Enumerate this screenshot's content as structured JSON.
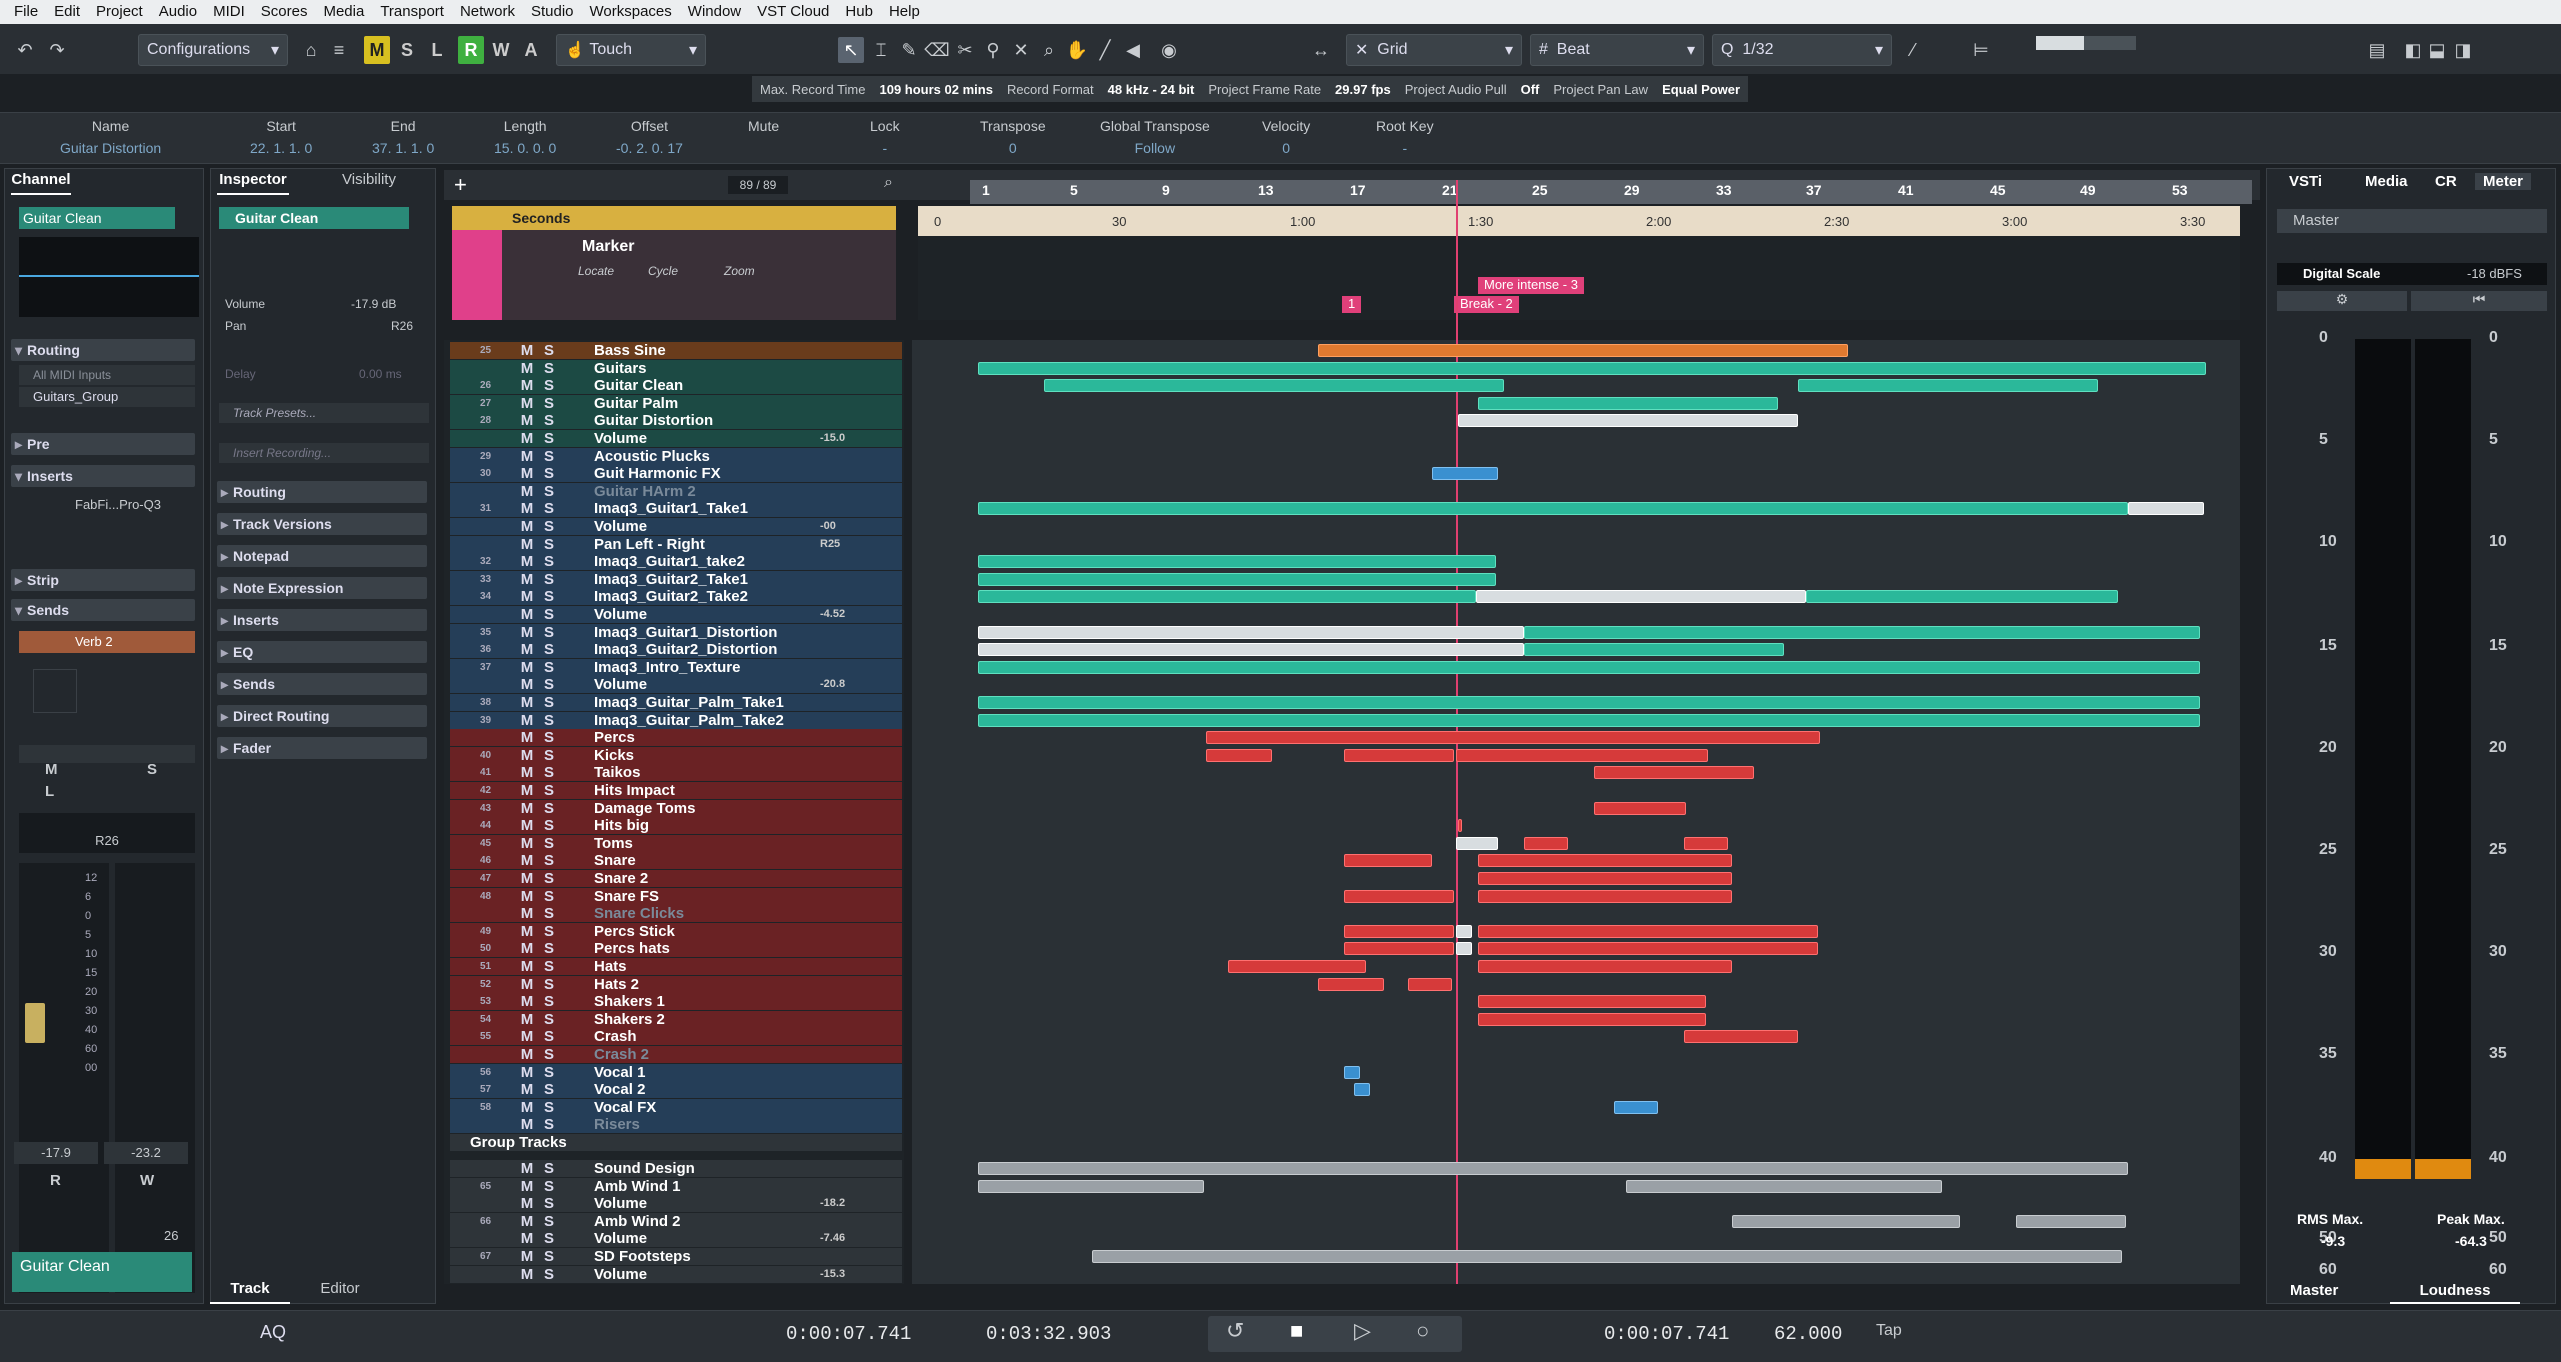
{
  "menu": [
    "File",
    "Edit",
    "Project",
    "Audio",
    "MIDI",
    "Scores",
    "Media",
    "Transport",
    "Network",
    "Studio",
    "Workspaces",
    "Window",
    "VST Cloud",
    "Hub",
    "Help"
  ],
  "toolbar": {
    "configurations": "Configurations",
    "automation_mode": "Touch",
    "snap_type": "Grid",
    "grid_type": "Beat",
    "quantize": "1/32",
    "ms_buttons": [
      "M",
      "S",
      "L",
      "R",
      "W",
      "A"
    ]
  },
  "status": {
    "max_record_label": "Max. Record Time",
    "max_record": "109 hours 02 mins",
    "record_format_label": "Record Format",
    "record_format": "48 kHz - 24 bit",
    "frame_rate_label": "Project Frame Rate",
    "frame_rate": "29.97 fps",
    "audio_pull_label": "Project Audio Pull",
    "audio_pull": "Off",
    "pan_law_label": "Project Pan Law",
    "pan_law": "Equal Power"
  },
  "infoline": {
    "cols": [
      {
        "h": "Name",
        "v": "Guitar Distortion"
      },
      {
        "h": "Start",
        "v": "22. 1. 1.    0"
      },
      {
        "h": "End",
        "v": "37. 1. 1.    0"
      },
      {
        "h": "Length",
        "v": "15. 0. 0.    0"
      },
      {
        "h": "Offset",
        "v": "-0. 2. 0.  17"
      },
      {
        "h": "Mute",
        "v": ""
      },
      {
        "h": "Lock",
        "v": "-"
      },
      {
        "h": "Transpose",
        "v": "0"
      },
      {
        "h": "Global Transpose",
        "v": "Follow"
      },
      {
        "h": "Velocity",
        "v": "0"
      },
      {
        "h": "Root Key",
        "v": "-"
      }
    ]
  },
  "channel": {
    "tab": "Channel",
    "track_name": "Guitar Clean",
    "routing": "Routing",
    "midi_input": "All MIDI Inputs",
    "output": "Guitars_Group",
    "pre": "Pre",
    "inserts": "Inserts",
    "insert_slot": "FabFi...Pro-Q3",
    "strip": "Strip",
    "sends": "Sends",
    "send_slot": "Verb 2",
    "pan_value": "R26",
    "fader_scale": [
      "12",
      "6",
      "0",
      "5",
      "10",
      "15",
      "20",
      "30",
      "40",
      "60",
      "00"
    ],
    "vol_readout": "-17.9",
    "peak_readout": "-23.2",
    "r_label": "R",
    "w_label": "W",
    "footer_value": "26",
    "footer_name": "Guitar Clean",
    "m": "M",
    "s": "S",
    "l": "L"
  },
  "inspector": {
    "tab": "Inspector",
    "tab2": "Visibility",
    "track_name": "Guitar Clean",
    "volume_label": "Volume",
    "volume": "-17.9 dB",
    "pan_label": "Pan",
    "pan": "R26",
    "delay_label": "Delay",
    "delay": "0.00 ms",
    "presets": "Track Presets...",
    "insert_recording": "Insert Recording...",
    "sections": [
      "Routing",
      "Track Versions",
      "Notepad",
      "Note Expression",
      "Inserts",
      "EQ",
      "Sends",
      "Direct Routing",
      "Fader"
    ],
    "footer_track": "Track",
    "footer_editor": "Editor"
  },
  "tracklist": {
    "count": "89 / 89",
    "seconds_ruler": "Seconds",
    "marker_track": "Marker",
    "marker_locate": "Locate",
    "marker_cycle": "Cycle",
    "marker_zoom": "Zoom",
    "markers": [
      {
        "label": "1"
      },
      {
        "label": "Break -  2"
      },
      {
        "label": "More intense -  3"
      }
    ],
    "group_tracks": "Group Tracks"
  },
  "tracks": [
    {
      "n": "25",
      "name": "Bass Sine",
      "color": "o"
    },
    {
      "n": "",
      "name": "Guitars",
      "color": "g"
    },
    {
      "n": "26",
      "name": "Guitar Clean",
      "color": "g"
    },
    {
      "n": "27",
      "name": "Guitar Palm",
      "color": "g"
    },
    {
      "n": "28",
      "name": "Guitar Distortion",
      "color": "g"
    },
    {
      "n": "",
      "name": "Volume",
      "color": "g",
      "sub": "-15.0"
    },
    {
      "n": "29",
      "name": "Acoustic Plucks",
      "color": "b"
    },
    {
      "n": "30",
      "name": "Guit Harmonic FX",
      "color": "b"
    },
    {
      "n": "",
      "name": "Guitar HArm 2",
      "color": "b",
      "dim": true
    },
    {
      "n": "31",
      "name": "Imaq3_Guitar1_Take1",
      "color": "b"
    },
    {
      "n": "",
      "name": "Volume",
      "color": "b",
      "sub": "-00"
    },
    {
      "n": "",
      "name": "Pan Left - Right",
      "color": "b",
      "sub": "R25"
    },
    {
      "n": "32",
      "name": "Imaq3_Guitar1_take2",
      "color": "b"
    },
    {
      "n": "33",
      "name": "Imaq3_Guitar2_Take1",
      "color": "b"
    },
    {
      "n": "34",
      "name": "Imaq3_Guitar2_Take2",
      "color": "b"
    },
    {
      "n": "",
      "name": "Volume",
      "color": "b",
      "sub": "-4.52"
    },
    {
      "n": "35",
      "name": "Imaq3_Guitar1_Distortion",
      "color": "b"
    },
    {
      "n": "36",
      "name": "Imaq3_Guitar2_Distortion",
      "color": "b"
    },
    {
      "n": "37",
      "name": "Imaq3_Intro_Texture",
      "color": "b"
    },
    {
      "n": "",
      "name": "Volume",
      "color": "b",
      "sub": "-20.8"
    },
    {
      "n": "38",
      "name": "Imaq3_Guitar_Palm_Take1",
      "color": "b"
    },
    {
      "n": "39",
      "name": "Imaq3_Guitar_Palm_Take2",
      "color": "b"
    },
    {
      "n": "",
      "name": "Percs",
      "color": "r"
    },
    {
      "n": "40",
      "name": "Kicks",
      "color": "r"
    },
    {
      "n": "41",
      "name": "Taikos",
      "color": "r"
    },
    {
      "n": "42",
      "name": "Hits Impact",
      "color": "r"
    },
    {
      "n": "43",
      "name": "Damage Toms",
      "color": "r"
    },
    {
      "n": "44",
      "name": "Hits big",
      "color": "r"
    },
    {
      "n": "45",
      "name": "Toms",
      "color": "r"
    },
    {
      "n": "46",
      "name": "Snare",
      "color": "r"
    },
    {
      "n": "47",
      "name": "Snare 2",
      "color": "r"
    },
    {
      "n": "48",
      "name": "Snare FS",
      "color": "r"
    },
    {
      "n": "",
      "name": "Snare Clicks",
      "color": "r",
      "dim": true
    },
    {
      "n": "49",
      "name": "Percs  Stick",
      "color": "r"
    },
    {
      "n": "50",
      "name": "Percs  hats",
      "color": "r"
    },
    {
      "n": "51",
      "name": "Hats",
      "color": "r"
    },
    {
      "n": "52",
      "name": "Hats 2",
      "color": "r"
    },
    {
      "n": "53",
      "name": "Shakers 1",
      "color": "r"
    },
    {
      "n": "54",
      "name": "Shakers 2",
      "color": "r"
    },
    {
      "n": "55",
      "name": "Crash",
      "color": "r"
    },
    {
      "n": "",
      "name": "Crash 2",
      "color": "r",
      "dim": true
    },
    {
      "n": "56",
      "name": "Vocal 1",
      "color": "b"
    },
    {
      "n": "57",
      "name": "Vocal 2",
      "color": "b"
    },
    {
      "n": "58",
      "name": "Vocal FX",
      "color": "b"
    },
    {
      "n": "",
      "name": "Risers",
      "color": "b",
      "dim": true
    }
  ],
  "group_tracks": [
    {
      "n": "",
      "name": "Sound Design"
    },
    {
      "n": "65",
      "name": "Amb Wind 1"
    },
    {
      "n": "",
      "name": "Volume",
      "sub": "-18.2"
    },
    {
      "n": "66",
      "name": "Amb Wind 2"
    },
    {
      "n": "",
      "name": "Volume",
      "sub": "-7.46"
    },
    {
      "n": "67",
      "name": "SD Footsteps"
    },
    {
      "n": "",
      "name": "Volume",
      "sub": "-15.3"
    }
  ],
  "ruler": {
    "bars": [
      "1",
      "5",
      "9",
      "13",
      "17",
      "21",
      "25",
      "29",
      "33",
      "37",
      "41",
      "45",
      "49",
      "53"
    ],
    "seconds": [
      "0",
      "30",
      "1:00",
      "1:30",
      "2:00",
      "2:30",
      "3:00",
      "3:30"
    ]
  },
  "right": {
    "tabs": [
      "VSTi",
      "Media",
      "CR",
      "Meter"
    ],
    "master_label": "Master",
    "digital_scale": "Digital Scale",
    "dbfs": "-18 dBFS",
    "scale": [
      "0",
      "5",
      "10",
      "15",
      "20",
      "25",
      "30",
      "35",
      "40",
      "50",
      "60"
    ],
    "rms_label": "RMS Max.",
    "rms": "-9.3",
    "peak_label": "Peak Max.",
    "peak": "-64.3",
    "footer_master": "Master",
    "footer_loudness": "Loudness"
  },
  "transport": {
    "left_time": "0:00:07.741",
    "right_time": "0:03:32.903",
    "pos_time": "0:00:07.741",
    "tempo": "62.000",
    "tap": "Tap",
    "aq": "AQ"
  },
  "colors": {
    "green": "#2bb89a",
    "red": "#d63a3a",
    "blue": "#3a90d0",
    "orange": "#e07a30",
    "accent": "#e8c820"
  }
}
